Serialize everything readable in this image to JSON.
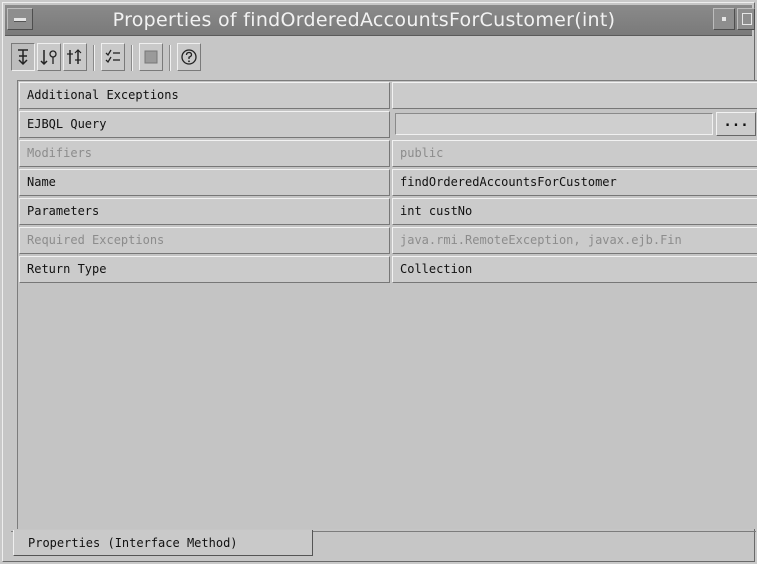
{
  "window": {
    "title": "Properties of findOrderedAccountsForCustomer(int)"
  },
  "toolbar": {
    "buttons": [
      {
        "icon": "sort-by-name-icon",
        "pressed": true
      },
      {
        "icon": "sort-by-type-icon",
        "pressed": false
      },
      {
        "icon": "unsorted-icon",
        "pressed": false
      },
      {
        "icon": "property-list-icon",
        "pressed": false
      },
      {
        "icon": "customize-icon",
        "pressed": false
      },
      {
        "icon": "help-icon",
        "pressed": false
      }
    ]
  },
  "properties": [
    {
      "name": "Additional Exceptions",
      "value": "",
      "enabled": true
    },
    {
      "name": "EJBQL Query",
      "value": "",
      "enabled": true,
      "ellipsis": "..."
    },
    {
      "name": "Modifiers",
      "value": "public",
      "enabled": false
    },
    {
      "name": "Name",
      "value": "findOrderedAccountsForCustomer",
      "enabled": true
    },
    {
      "name": "Parameters",
      "value": "int custNo",
      "enabled": true
    },
    {
      "name": "Required Exceptions",
      "value": "java.rmi.RemoteException, javax.ejb.Fin",
      "enabled": false
    },
    {
      "name": "Return Type",
      "value": "Collection",
      "enabled": true
    }
  ],
  "tabs": {
    "active_label": "Properties (Interface Method)"
  }
}
